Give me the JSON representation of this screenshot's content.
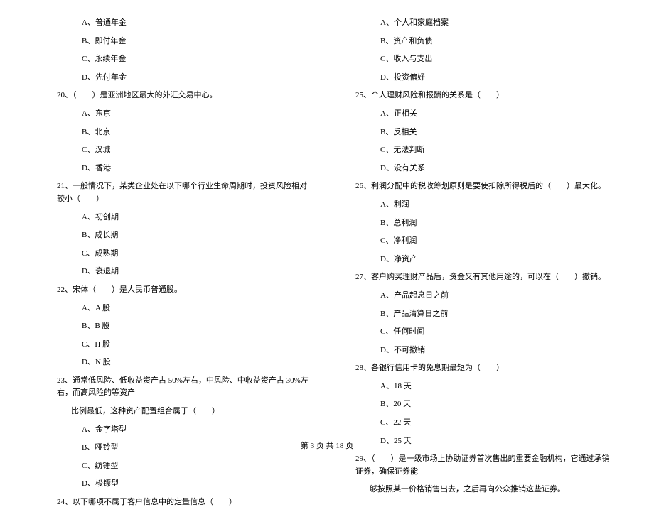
{
  "left": {
    "options_before_q20": [
      "A、普通年金",
      "B、即付年金",
      "C、永续年金",
      "D、先付年金"
    ],
    "q20": {
      "text": "20、（　　）是亚洲地区最大的外汇交易中心。",
      "options": [
        "A、东京",
        "B、北京",
        "C、汉城",
        "D、香港"
      ]
    },
    "q21": {
      "text": "21、一般情况下，某类企业处在以下哪个行业生命周期时，投资风险相对较小（　　）",
      "options": [
        "A、初创期",
        "B、成长期",
        "C、成熟期",
        "D、衰退期"
      ]
    },
    "q22": {
      "text": "22、宋体（　　）是人民币普通股。",
      "options": [
        "A、A 股",
        "B、B 股",
        "C、H 股",
        "D、N 股"
      ]
    },
    "q23": {
      "text": "23、通常低风险、低收益资产占 50%左右，中风险、中收益资产占 30%左右，而高风险的等资产",
      "cont": "比例最低，这种资产配置组合属于（　　）",
      "options": [
        "A、金字塔型",
        "B、哑铃型",
        "C、纺锤型",
        "D、梭镖型"
      ]
    },
    "q24": {
      "text": "24、以下哪项不属于客户信息中的定量信息（　　）"
    }
  },
  "right": {
    "options_before_q25": [
      "A、个人和家庭档案",
      "B、资产和负债",
      "C、收入与支出",
      "D、投资偏好"
    ],
    "q25": {
      "text": "25、个人理财风险和报酬的关系是（　　）",
      "options": [
        "A、正相关",
        "B、反相关",
        "C、无法判断",
        "D、没有关系"
      ]
    },
    "q26": {
      "text": "26、利润分配中的税收筹划原则是要使扣除所得税后的（　　）最大化。",
      "options": [
        "A、利润",
        "B、总利润",
        "C、净利润",
        "D、净资产"
      ]
    },
    "q27": {
      "text": "27、客户购买理财产品后，资金又有其他用途的，可以在（　　）撤销。",
      "options": [
        "A、产品起息日之前",
        "B、产品清算日之前",
        "C、任何时间",
        "D、不可撤销"
      ]
    },
    "q28": {
      "text": "28、各银行信用卡的免息期最短为（　　）",
      "options": [
        "A、18 天",
        "B、20 天",
        "C、22 天",
        "D、25 天"
      ]
    },
    "q29": {
      "text": "29、（　　）是一级市场上协助证券首次售出的重要金融机构，它通过承销证券，确保证券能",
      "cont": "够按照某一价格销售出去，之后再向公众推销这些证券。"
    }
  },
  "footer": "第 3 页 共 18 页"
}
